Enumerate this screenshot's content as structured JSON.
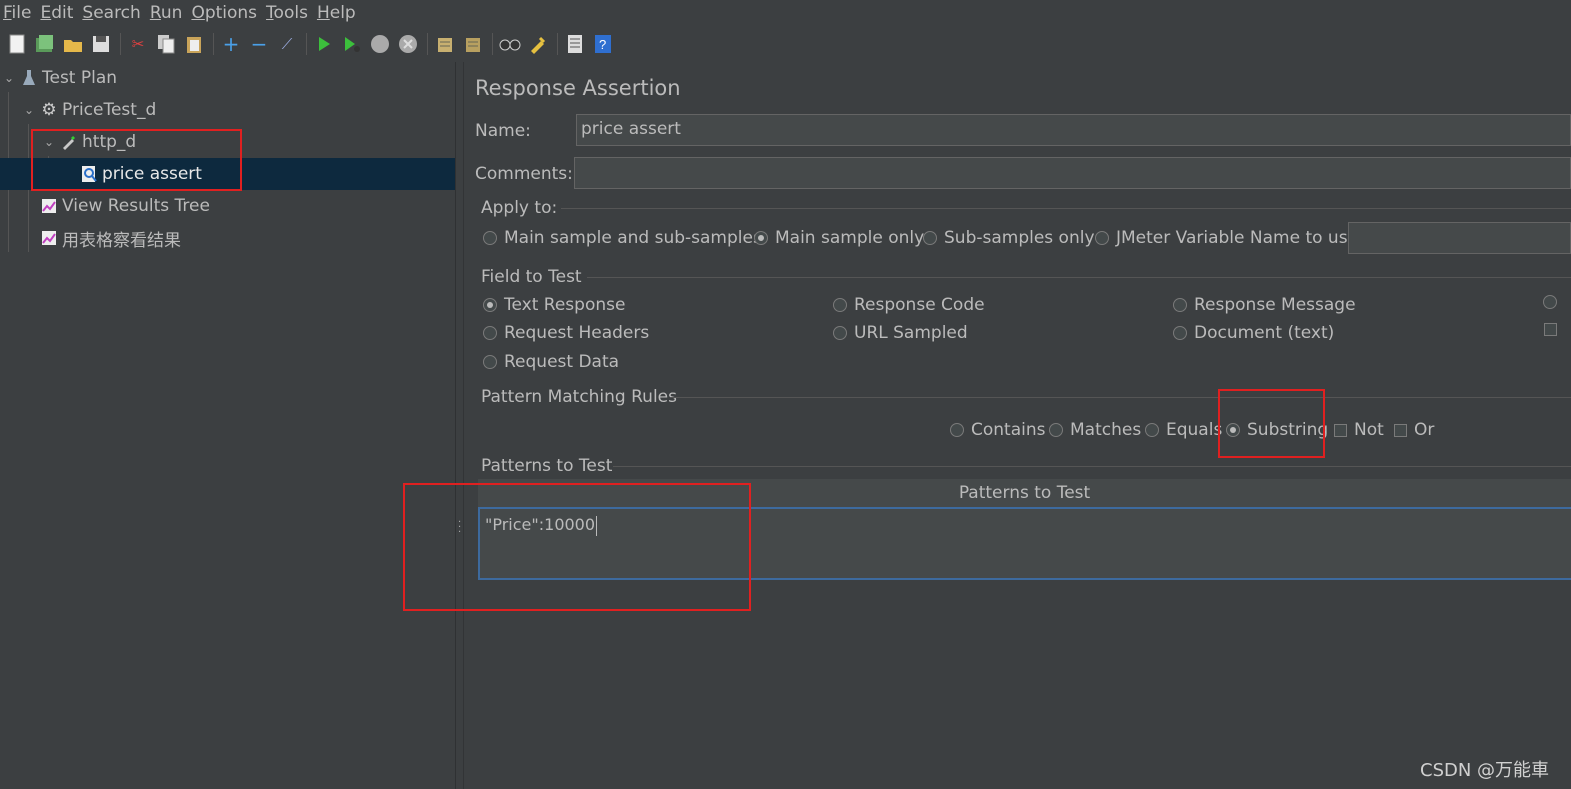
{
  "menu": [
    "File",
    "Edit",
    "Search",
    "Run",
    "Options",
    "Tools",
    "Help"
  ],
  "toolbar_icons": [
    "new-icon",
    "templates-icon",
    "open-icon",
    "save-icon",
    "cut-icon",
    "copy-icon",
    "paste-icon",
    "expand-icon",
    "collapse-icon",
    "toggle-icon",
    "start-icon",
    "start-no-pause-icon",
    "stop-icon",
    "shutdown-icon",
    "clear-icon",
    "clear-all-icon",
    "search-icon",
    "reset-search-icon",
    "function-helper-icon",
    "help-icon"
  ],
  "tree": {
    "items": [
      {
        "label": "Test Plan",
        "icon": "flask-icon"
      },
      {
        "label": "PriceTest_d",
        "icon": "gear-icon"
      },
      {
        "label": "http_d",
        "icon": "pipette-icon"
      },
      {
        "label": "price assert",
        "icon": "assertion-icon"
      },
      {
        "label": "View Results Tree",
        "icon": "graph-icon"
      },
      {
        "label": "用表格察看结果",
        "icon": "graph-icon"
      }
    ]
  },
  "panel": {
    "title": "Response Assertion",
    "name_label": "Name:",
    "name_value": "price assert",
    "comments_label": "Comments:",
    "comments_value": "",
    "apply_to": {
      "label": "Apply to:",
      "options": [
        "Main sample and sub-samples",
        "Main sample only",
        "Sub-samples only",
        "JMeter Variable Name to use"
      ],
      "selected": "Main sample only",
      "variable_value": ""
    },
    "field_to_test": {
      "label": "Field to Test",
      "options": [
        "Text Response",
        "Response Code",
        "Response Message",
        "Request Headers",
        "URL Sampled",
        "Document (text)",
        "Request Data"
      ],
      "selected": "Text Response"
    },
    "pattern_rules": {
      "label": "Pattern Matching Rules",
      "options": [
        "Contains",
        "Matches",
        "Equals",
        "Substring"
      ],
      "selected": "Substring",
      "checkboxes": [
        "Not",
        "Or"
      ]
    },
    "patterns": {
      "label": "Patterns to Test",
      "column_header": "Patterns to Test",
      "rows": [
        "\"Price\":10000"
      ]
    }
  },
  "watermark": "CSDN @万能車"
}
